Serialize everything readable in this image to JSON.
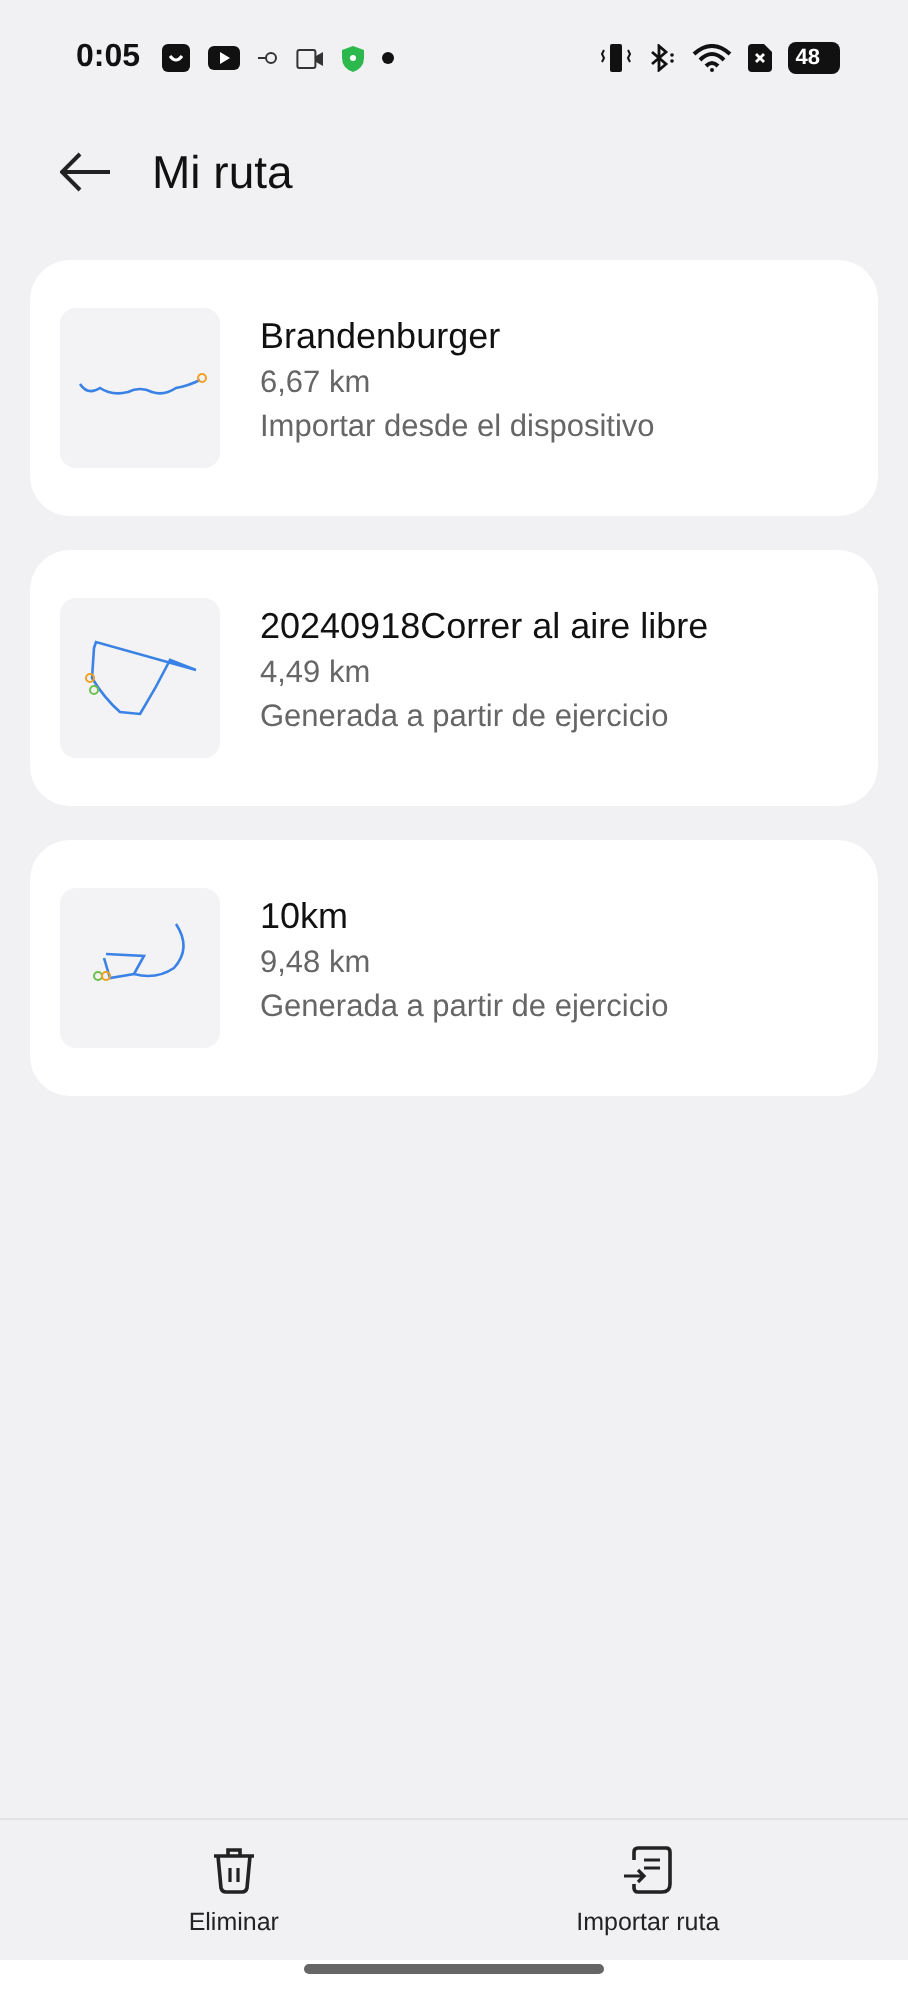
{
  "status_bar": {
    "time": "0:05",
    "battery": "48"
  },
  "header": {
    "title": "Mi ruta"
  },
  "routes": [
    {
      "name": "Brandenburger",
      "distance": "6,67 km",
      "source": "Importar desde el dispositivo"
    },
    {
      "name": "20240918Correr al aire libre",
      "distance": "4,49 km",
      "source": "Generada a partir de ejercicio"
    },
    {
      "name": "10km",
      "distance": "9,48 km",
      "source": "Generada a partir de ejercicio"
    }
  ],
  "bottom_bar": [
    {
      "kind": "delete",
      "label": "Eliminar"
    },
    {
      "kind": "import",
      "label": "Importar ruta"
    }
  ]
}
